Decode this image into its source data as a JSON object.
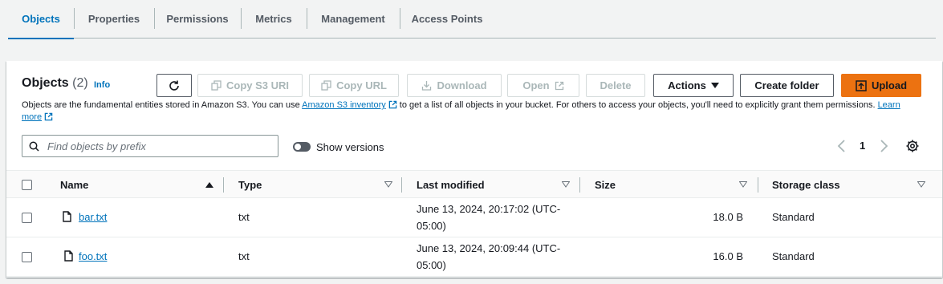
{
  "tabs": [
    {
      "label": "Objects"
    },
    {
      "label": "Properties"
    },
    {
      "label": "Permissions"
    },
    {
      "label": "Metrics"
    },
    {
      "label": "Management"
    },
    {
      "label": "Access Points"
    }
  ],
  "panel": {
    "title": "Objects",
    "count": "(2)",
    "info": "Info",
    "description": {
      "prefix": "Objects are the fundamental entities stored in Amazon S3. You can use ",
      "inventory_link": "Amazon S3 inventory",
      "middle": " to get a list of all objects in your bucket. For others to access your objects, you'll need to explicitly grant them permissions. ",
      "learn_more": "Learn more"
    }
  },
  "toolbar": {
    "copy_uri": "Copy S3 URI",
    "copy_url": "Copy URL",
    "download": "Download",
    "open": "Open",
    "delete": "Delete",
    "actions": "Actions",
    "create_folder": "Create folder",
    "upload": "Upload"
  },
  "search": {
    "placeholder": "Find objects by prefix"
  },
  "show_versions": "Show versions",
  "pagination": {
    "page": "1"
  },
  "table": {
    "columns": [
      "Name",
      "Type",
      "Last modified",
      "Size",
      "Storage class"
    ],
    "rows": [
      {
        "name": "bar.txt",
        "type": "txt",
        "last_modified": "June 13, 2024, 20:17:02 (UTC-05:00)",
        "size": "18.0 B",
        "storage_class": "Standard"
      },
      {
        "name": "foo.txt",
        "type": "txt",
        "last_modified": "June 13, 2024, 20:09:44 (UTC-05:00)",
        "size": "16.0 B",
        "storage_class": "Standard"
      }
    ]
  },
  "colors": {
    "accent": "#0073bb",
    "primary_button": "#ec7211",
    "disabled": "#aab7b8"
  }
}
